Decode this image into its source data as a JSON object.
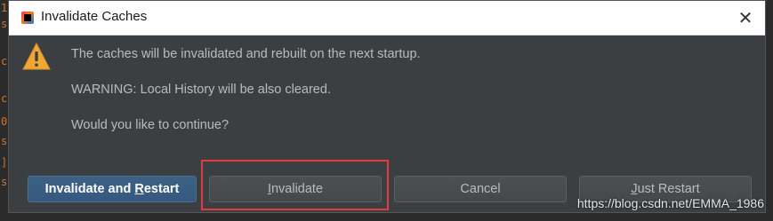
{
  "window": {
    "title": "Invalidate Caches",
    "close_glyph": "✕"
  },
  "messages": {
    "line1": "The caches will be invalidated and rebuilt on the next startup.",
    "line2": "WARNING: Local History will be also cleared.",
    "line3": "Would you like to continue?"
  },
  "buttons": {
    "invalidate_restart": {
      "pre": "Invalidate and ",
      "mnemonic": "R",
      "post": "estart"
    },
    "invalidate": {
      "pre": "",
      "mnemonic": "I",
      "post": "nvalidate"
    },
    "cancel": {
      "pre": "",
      "mnemonic": "",
      "post": "Cancel"
    },
    "just_restart": {
      "pre": "",
      "mnemonic": "J",
      "post": "ust Restart"
    }
  },
  "watermark": "https://blog.csdn.net/EMMA_1986",
  "icons": {
    "app": "intellij-app-icon",
    "warning": "warning-triangle-icon",
    "close": "close-icon"
  },
  "colors": {
    "dialog_bg": "#3c3f41",
    "default_button": "#365880",
    "highlight_box": "#e03c3c",
    "warning_fill": "#f0a732"
  }
}
